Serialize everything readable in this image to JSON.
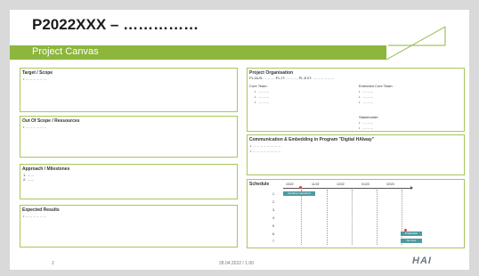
{
  "header": {
    "title": "P2022XXX – ……………",
    "subtitle": "Project Canvas"
  },
  "left_boxes": [
    {
      "title": "Target / Scope",
      "lines": [
        "• ………………"
      ]
    },
    {
      "title": "Out Of Scope / Ressources",
      "lines": [
        "• ………………"
      ]
    },
    {
      "title": "Approach / Milestones",
      "lines": [
        "1. ……",
        "2. ……"
      ]
    },
    {
      "title": "Expected Results",
      "lines": [
        "• ………………"
      ]
    }
  ],
  "organisation": {
    "title": "Project Organisation",
    "roles": "PL-BUS: ……… PL-IT: ………, PL-EXT: ………………",
    "core_label": "Core Team:",
    "core_items": [
      "………",
      "………",
      "………"
    ],
    "ext_label": "Extended Core Team:",
    "ext_items": [
      "………",
      "………",
      "………"
    ],
    "stake_label": "Stakeholder:",
    "stake_items": [
      "………",
      "………"
    ]
  },
  "communication": {
    "title": "Communication & Embedding in Program \"Digital HAIway\"",
    "lines": [
      "• ……………………",
      "• ……………………"
    ]
  },
  "schedule": {
    "title": "Schedule",
    "periods": [
      "10/22",
      "11/22",
      "12/22",
      "01/23",
      "02/23"
    ],
    "rows": [
      "1.",
      "2.",
      "3.",
      "4.",
      "5.",
      "6.",
      "7."
    ],
    "bars": [
      "Desktop Launched",
      "Production",
      "Go-Live"
    ]
  },
  "footer": {
    "page": "2",
    "date": "28.04.2022 / 1.00",
    "logo": "HAI"
  },
  "colors": {
    "accent": "#8cb63c",
    "bar": "#4f9aa0",
    "marker": "#e0432e"
  }
}
